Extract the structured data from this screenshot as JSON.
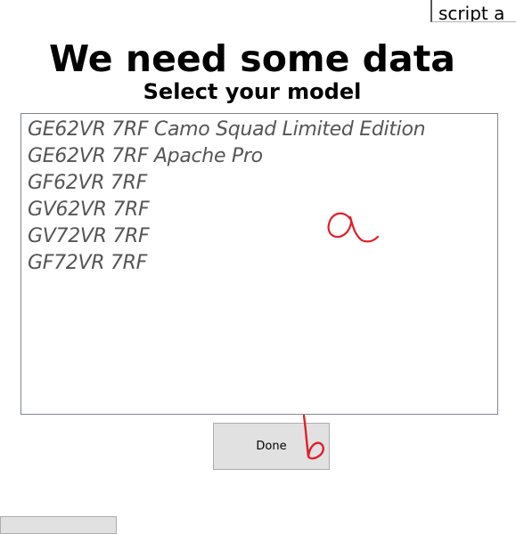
{
  "corner_window": {
    "text": "script a"
  },
  "dialog": {
    "title": "We need some data",
    "subtitle": "Select your model",
    "models": [
      "GE62VR 7RF Camo Squad Limited Edition",
      "GE62VR 7RF Apache Pro",
      "GF62VR 7RF",
      "GV62VR 7RF",
      "GV72VR 7RF",
      "GF72VR 7RF"
    ],
    "done_label": "Done"
  },
  "annotations": {
    "marker_a": "a",
    "marker_b": "b",
    "ink_color": "#e0202a"
  }
}
